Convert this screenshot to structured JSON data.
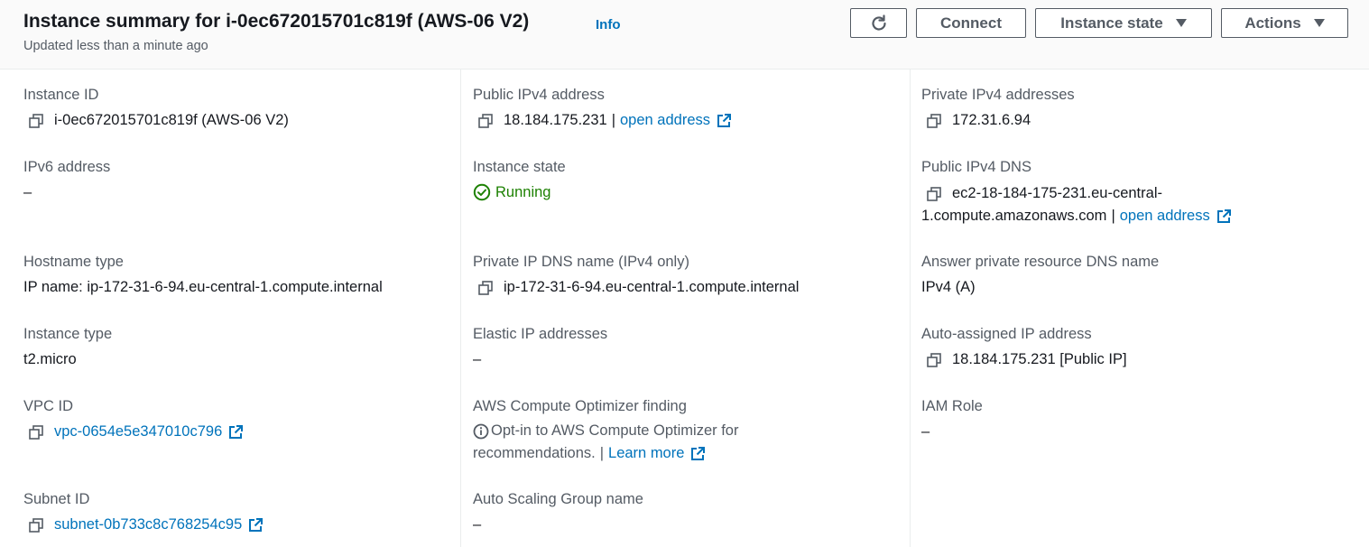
{
  "header": {
    "title": "Instance summary for i-0ec672015701c819f (AWS-06 V2)",
    "info_link": "Info",
    "updated": "Updated less than a minute ago",
    "buttons": {
      "connect": "Connect",
      "instance_state": "Instance state",
      "actions": "Actions"
    }
  },
  "col1": {
    "instance_id": {
      "label": "Instance ID",
      "value": "i-0ec672015701c819f (AWS-06 V2)"
    },
    "ipv6": {
      "label": "IPv6 address",
      "value": "–"
    },
    "hostname_type": {
      "label": "Hostname type",
      "value": "IP name: ip-172-31-6-94.eu-central-1.compute.internal"
    },
    "instance_type": {
      "label": "Instance type",
      "value": "t2.micro"
    },
    "vpc": {
      "label": "VPC ID",
      "value": "vpc-0654e5e347010c796"
    },
    "subnet": {
      "label": "Subnet ID",
      "value": "subnet-0b733c8c768254c95"
    }
  },
  "col2": {
    "public_ipv4": {
      "label": "Public IPv4 address",
      "value": "18.184.175.231",
      "sep": "|",
      "link": "open address"
    },
    "instance_state": {
      "label": "Instance state",
      "value": "Running"
    },
    "private_dns": {
      "label": "Private IP DNS name (IPv4 only)",
      "value": "ip-172-31-6-94.eu-central-1.compute.internal"
    },
    "elastic_ip": {
      "label": "Elastic IP addresses",
      "value": "–"
    },
    "optimizer": {
      "label": "AWS Compute Optimizer finding",
      "line1": "Opt-in to AWS Compute Optimizer for",
      "line2": "recommendations.",
      "sep": "|",
      "link": "Learn more"
    },
    "asg": {
      "label": "Auto Scaling Group name",
      "value": "–"
    }
  },
  "col3": {
    "private_ipv4": {
      "label": "Private IPv4 addresses",
      "value": "172.31.6.94"
    },
    "public_dns": {
      "label": "Public IPv4 DNS",
      "line1": "ec2-18-184-175-231.eu-central-",
      "line2": "1.compute.amazonaws.com",
      "sep": "|",
      "link": "open address"
    },
    "answer_dns": {
      "label": "Answer private resource DNS name",
      "value": "IPv4 (A)"
    },
    "auto_ip": {
      "label": "Auto-assigned IP address",
      "value": "18.184.175.231 [Public IP]"
    },
    "iam": {
      "label": "IAM Role",
      "value": "–"
    }
  },
  "colors": {
    "link": "#0073bb",
    "running": "#1d8102",
    "label": "#545b64",
    "text": "#16191f"
  }
}
